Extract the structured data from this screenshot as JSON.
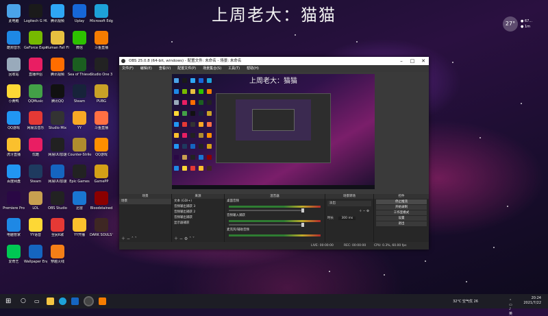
{
  "wallpaper": {
    "title": "上周老大：猫猫"
  },
  "desktop_icons": [
    {
      "label": "此电脑",
      "color": "#4aa3e8"
    },
    {
      "label": "Logitech G HUB",
      "color": "#1a1a1a"
    },
    {
      "label": "腾讯视频",
      "color": "#2ea6f5"
    },
    {
      "label": "Uplay",
      "color": "#1667d8"
    },
    {
      "label": "Microsoft Edge",
      "color": "#1da1d8"
    },
    {
      "label": "酷狗音乐",
      "color": "#1e88e5"
    },
    {
      "label": "GeForce Experience",
      "color": "#76b900"
    },
    {
      "label": "Human Fall Flat",
      "color": "#e8c040"
    },
    {
      "label": "微信",
      "color": "#2dc100"
    },
    {
      "label": "斗鱼直播",
      "color": "#f57c00"
    },
    {
      "label": "回收站",
      "color": "#9ab"
    },
    {
      "label": "直播伴侣",
      "color": "#e91e63"
    },
    {
      "label": "腾讯视频",
      "color": "#ff6d00"
    },
    {
      "label": "Sea of Thieves",
      "color": "#1b5e20"
    },
    {
      "label": "Studio One 3",
      "color": "#222"
    },
    {
      "label": "小黄鸭",
      "color": "#fdd835"
    },
    {
      "label": "QQMusic",
      "color": "#43a047"
    },
    {
      "label": "腾讯QQ",
      "color": "#111"
    },
    {
      "label": "Steam",
      "color": "#17233a"
    },
    {
      "label": "PUBG",
      "color": "#c9a227"
    },
    {
      "label": "QQ游戏",
      "color": "#2196f3"
    },
    {
      "label": "网易云音乐",
      "color": "#e53935"
    },
    {
      "label": "Studio Mix",
      "color": "#333"
    },
    {
      "label": "YY",
      "color": "#f9a825"
    },
    {
      "label": "斗鱼直播",
      "color": "#ff7043"
    },
    {
      "label": "虎牙直播",
      "color": "#fbc02d"
    },
    {
      "label": "优酷",
      "color": "#e91e63"
    },
    {
      "label": "网易UU加速",
      "color": "#212121"
    },
    {
      "label": "Counter-Strike",
      "color": "#b08d2e"
    },
    {
      "label": "QQ游戏",
      "color": "#ff8f00"
    },
    {
      "label": "百度网盘",
      "color": "#2196f3"
    },
    {
      "label": "Steam",
      "color": "#1e3a5f"
    },
    {
      "label": "网易UU加速",
      "color": "#1565c0"
    },
    {
      "label": "Epic Games",
      "color": "#222"
    },
    {
      "label": "GamePP",
      "color": "#d4a017"
    },
    {
      "label": "Premiere Pro",
      "color": "#2a0845"
    },
    {
      "label": "LOL",
      "color": "#c8a050"
    },
    {
      "label": "OBS Studio",
      "color": "#222"
    },
    {
      "label": "迅雷",
      "color": "#1976d2"
    },
    {
      "label": "Bloodstained",
      "color": "#8b0000"
    },
    {
      "label": "电脑管家",
      "color": "#1e88e5"
    },
    {
      "label": "YY语音",
      "color": "#fdd835"
    },
    {
      "label": "全民K歌",
      "color": "#e53935"
    },
    {
      "label": "YY开播",
      "color": "#fbc02d"
    },
    {
      "label": "DARK SOULS™ III",
      "color": "#3e2723"
    },
    {
      "label": "爱奇艺",
      "color": "#00c853"
    },
    {
      "label": "Wallpaper Engine",
      "color": "#1565c0"
    },
    {
      "label": "穿越火线",
      "color": "#f57f17"
    }
  ],
  "weather_widget": {
    "temp": "27°",
    "line1": "● 67...",
    "line2": "● 1m"
  },
  "obs": {
    "window_title": "OBS 25.0.8 (64-bit, windows) - 配置文件: 未命名 - 场景: 未命名",
    "menu": [
      "文件(F)",
      "编辑(E)",
      "查看(V)",
      "配置文件(P)",
      "场景集合(S)",
      "工具(T)",
      "帮助(H)"
    ],
    "preview_title": "上周老大：猫猫",
    "docks": {
      "scenes": {
        "header": "场景",
        "items": [
          "场景"
        ]
      },
      "sources": {
        "header": "来源",
        "items": [
          "文本 (GDI+)",
          "音频输出捕获 3",
          "音频输出捕获 2",
          "音频输出捕获",
          "显示器捕获"
        ]
      },
      "mixer": {
        "header": "混音器",
        "channels": [
          {
            "name": "桌面音频",
            "level": "-4.7 dB"
          },
          {
            "name": "音频输入捕获",
            "level": "0.0 dB"
          },
          {
            "name": "麦克风/辅助音频",
            "level": "-1.4 dB"
          }
        ]
      },
      "transitions": {
        "header": "场景转场",
        "type": "淡出",
        "duration_label": "时长",
        "duration": "300 ms"
      },
      "controls": {
        "header": "控件",
        "buttons": [
          "停止推流",
          "开始录制",
          "工作室模式",
          "设置",
          "退出"
        ]
      }
    },
    "statusbar": {
      "live": "LIVE: 00:00:00",
      "rec": "REC: 00:00:00",
      "cpu": "CPU: 0.3%, 60.00 fps"
    }
  },
  "taskbar": {
    "weather": "32°C 空气优 26",
    "time": "20:24",
    "date": "2021/7/22"
  }
}
